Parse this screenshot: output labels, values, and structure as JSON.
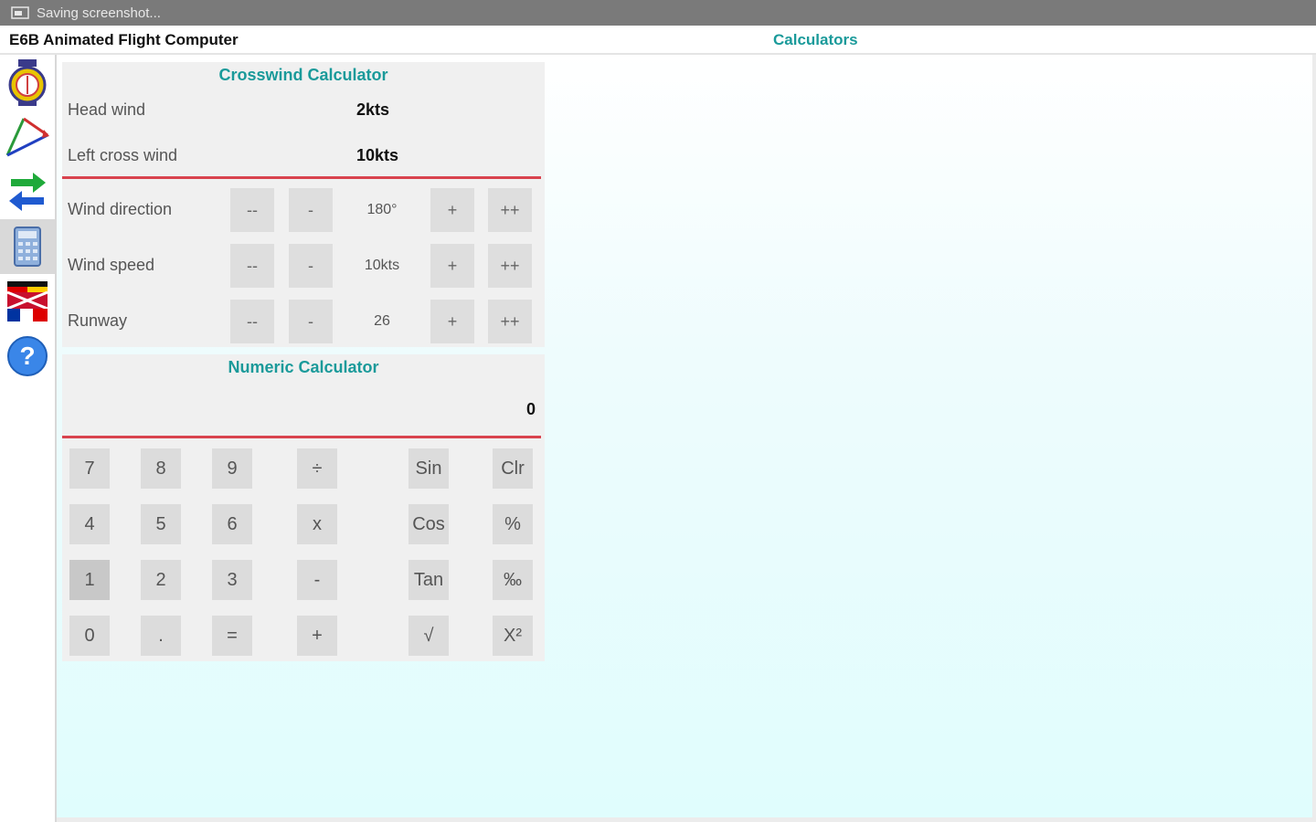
{
  "status_bar": {
    "text": "Saving screenshot..."
  },
  "title_bar": {
    "app_title": "E6B Animated Flight Computer",
    "section_title": "Calculators"
  },
  "sidebar": {
    "items": [
      {
        "icon": "compass-icon"
      },
      {
        "icon": "wind-triangle-icon"
      },
      {
        "icon": "convert-arrows-icon"
      },
      {
        "icon": "calculator-icon",
        "active": true
      },
      {
        "icon": "language-flags-icon"
      },
      {
        "icon": "help-icon"
      }
    ]
  },
  "crosswind": {
    "title": "Crosswind Calculator",
    "head_wind_label": "Head wind",
    "head_wind_value": "2kts",
    "cross_wind_label": "Left cross wind",
    "cross_wind_value": "10kts",
    "rows": [
      {
        "label": "Wind direction",
        "value": "180°"
      },
      {
        "label": "Wind speed",
        "value": "10kts"
      },
      {
        "label": "Runway",
        "value": "26"
      }
    ],
    "buttons": {
      "dec_big": "--",
      "dec": "-",
      "inc": "+",
      "inc_big": "++"
    }
  },
  "numeric": {
    "title": "Numeric Calculator",
    "display": "0",
    "keys": [
      [
        "7",
        "8",
        "9",
        "÷",
        "Sin",
        "Clr"
      ],
      [
        "4",
        "5",
        "6",
        "x",
        "Cos",
        "%"
      ],
      [
        "1",
        "2",
        "3",
        "-",
        "Tan",
        "‰"
      ],
      [
        "0",
        ".",
        "=",
        "+",
        "√",
        "X²"
      ]
    ]
  },
  "colors": {
    "accent": "#1a9a9a",
    "divider": "#d9434e",
    "status_bar": "#7a7a7a"
  }
}
